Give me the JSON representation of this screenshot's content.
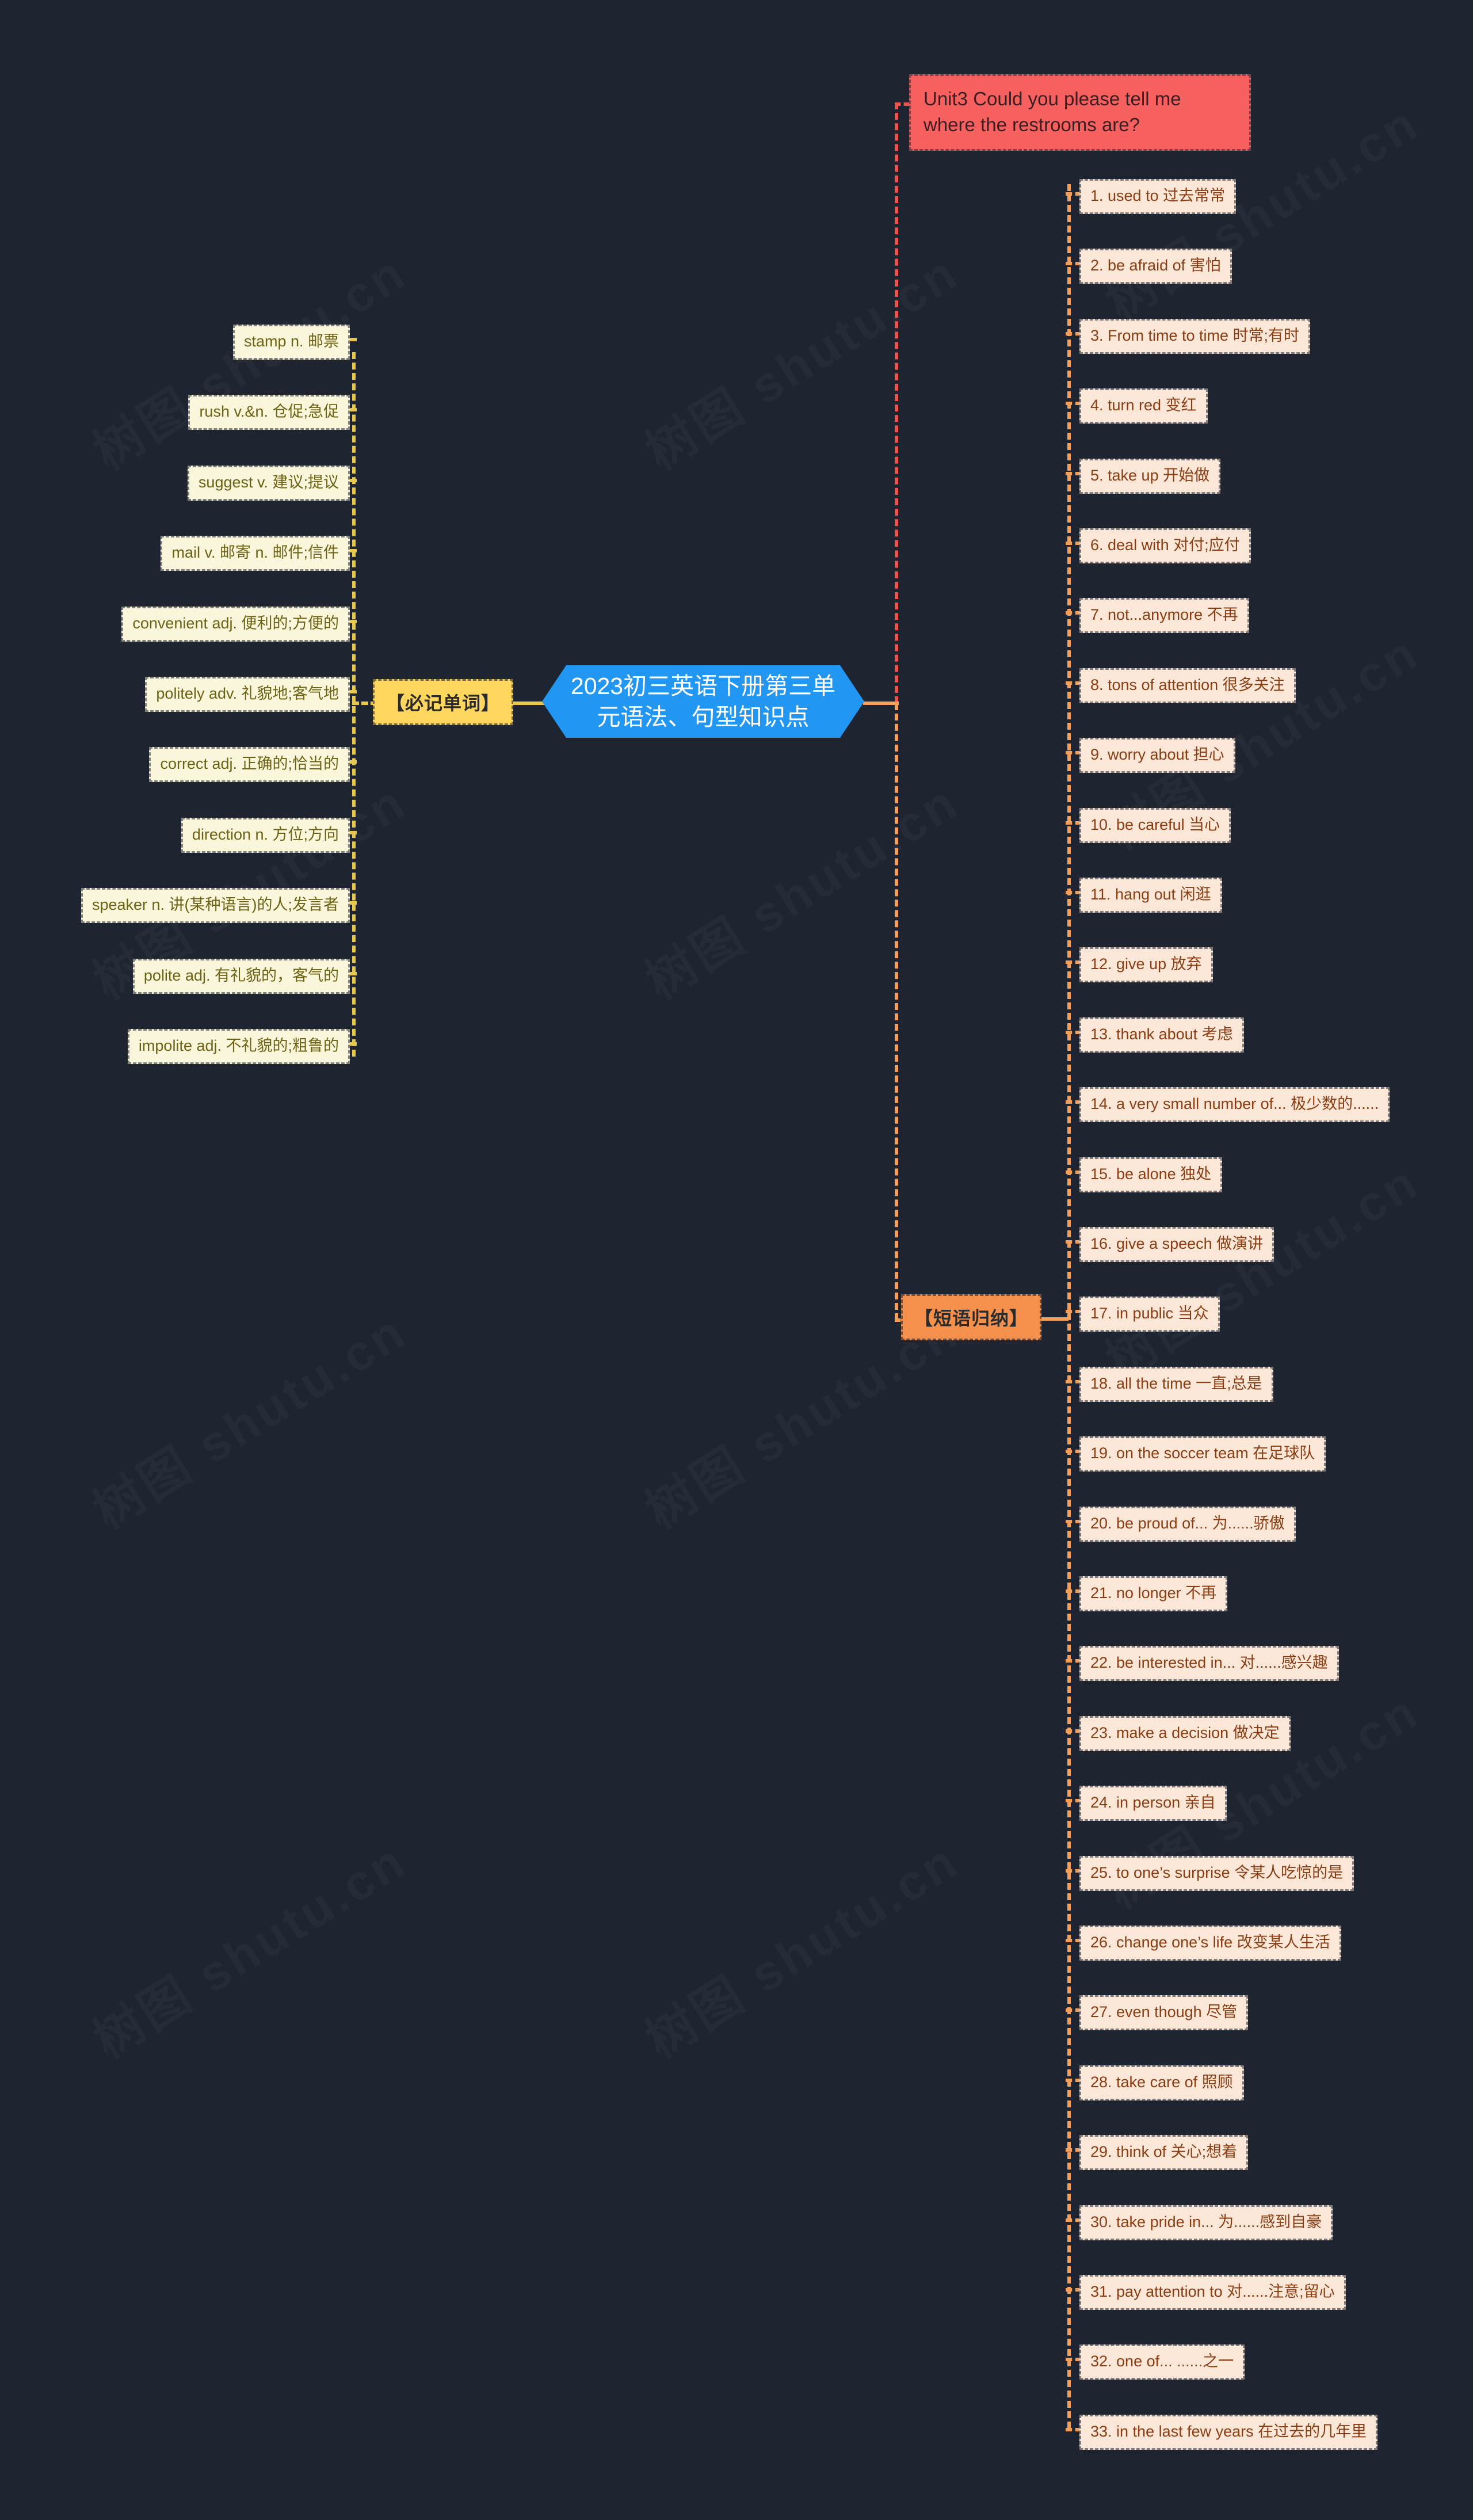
{
  "canvas": {
    "background": "#1e2430",
    "watermark": "树图 shutu.cn"
  },
  "root": {
    "label": "2023初三英语下册第三单元语法、句型知识点",
    "color": "#2196f3"
  },
  "branches": {
    "words": {
      "label": "【必记单词】",
      "color": "#ffd75e",
      "line_color": "#e8c84b",
      "items": [
        {
          "label": "stamp n. 邮票"
        },
        {
          "label": "rush v.&n. 仓促;急促"
        },
        {
          "label": "suggest v. 建议;提议"
        },
        {
          "label": "mail v. 邮寄 n. 邮件;信件"
        },
        {
          "label": "convenient adj. 便利的;方便的"
        },
        {
          "label": "politely adv. 礼貌地;客气地"
        },
        {
          "label": "correct adj. 正确的;恰当的"
        },
        {
          "label": "direction n. 方位;方向"
        },
        {
          "label": "speaker n. 讲(某种语言)的人;发言者"
        },
        {
          "label": "polite adj. 有礼貌的，客气的"
        },
        {
          "label": "impolite adj. 不礼貌的;粗鲁的"
        }
      ]
    },
    "topic": {
      "label": "Unit3 Could you please tell me where the restrooms are?",
      "color": "#f6615f",
      "line_color": "#ef5350"
    },
    "phrases": {
      "label": "【短语归纳】",
      "color": "#f5904d",
      "line_color": "#f5a05a",
      "items": [
        {
          "label": "1. used to 过去常常"
        },
        {
          "label": "2. be afraid of 害怕"
        },
        {
          "label": "3. From time to time 时常;有时"
        },
        {
          "label": "4. turn red 变红"
        },
        {
          "label": "5. take up 开始做"
        },
        {
          "label": "6. deal with 对付;应付"
        },
        {
          "label": "7. not...anymore 不再"
        },
        {
          "label": "8. tons of attention 很多关注"
        },
        {
          "label": "9. worry about 担心"
        },
        {
          "label": "10. be careful 当心"
        },
        {
          "label": "11. hang out 闲逛"
        },
        {
          "label": "12. give up 放弃"
        },
        {
          "label": "13. thank about 考虑"
        },
        {
          "label": "14. a very small number of... 极少数的......"
        },
        {
          "label": "15. be alone 独处"
        },
        {
          "label": "16. give a speech 做演讲"
        },
        {
          "label": "17. in public 当众"
        },
        {
          "label": "18. all the time 一直;总是"
        },
        {
          "label": "19. on the soccer team 在足球队"
        },
        {
          "label": "20. be proud of... 为......骄傲"
        },
        {
          "label": "21. no longer 不再"
        },
        {
          "label": "22. be interested in... 对......感兴趣"
        },
        {
          "label": "23. make a decision 做决定"
        },
        {
          "label": "24. in person 亲自"
        },
        {
          "label": "25. to one’s surprise 令某人吃惊的是"
        },
        {
          "label": "26. change one’s life 改变某人生活"
        },
        {
          "label": "27. even though 尽管"
        },
        {
          "label": "28. take care of 照顾"
        },
        {
          "label": "29. think of 关心;想着"
        },
        {
          "label": "30. take pride in... 为......感到自豪"
        },
        {
          "label": "31. pay attention to 对......注意;留心"
        },
        {
          "label": "32. one of... ......之一"
        },
        {
          "label": "33. in the last few years 在过去的几年里"
        }
      ]
    }
  }
}
